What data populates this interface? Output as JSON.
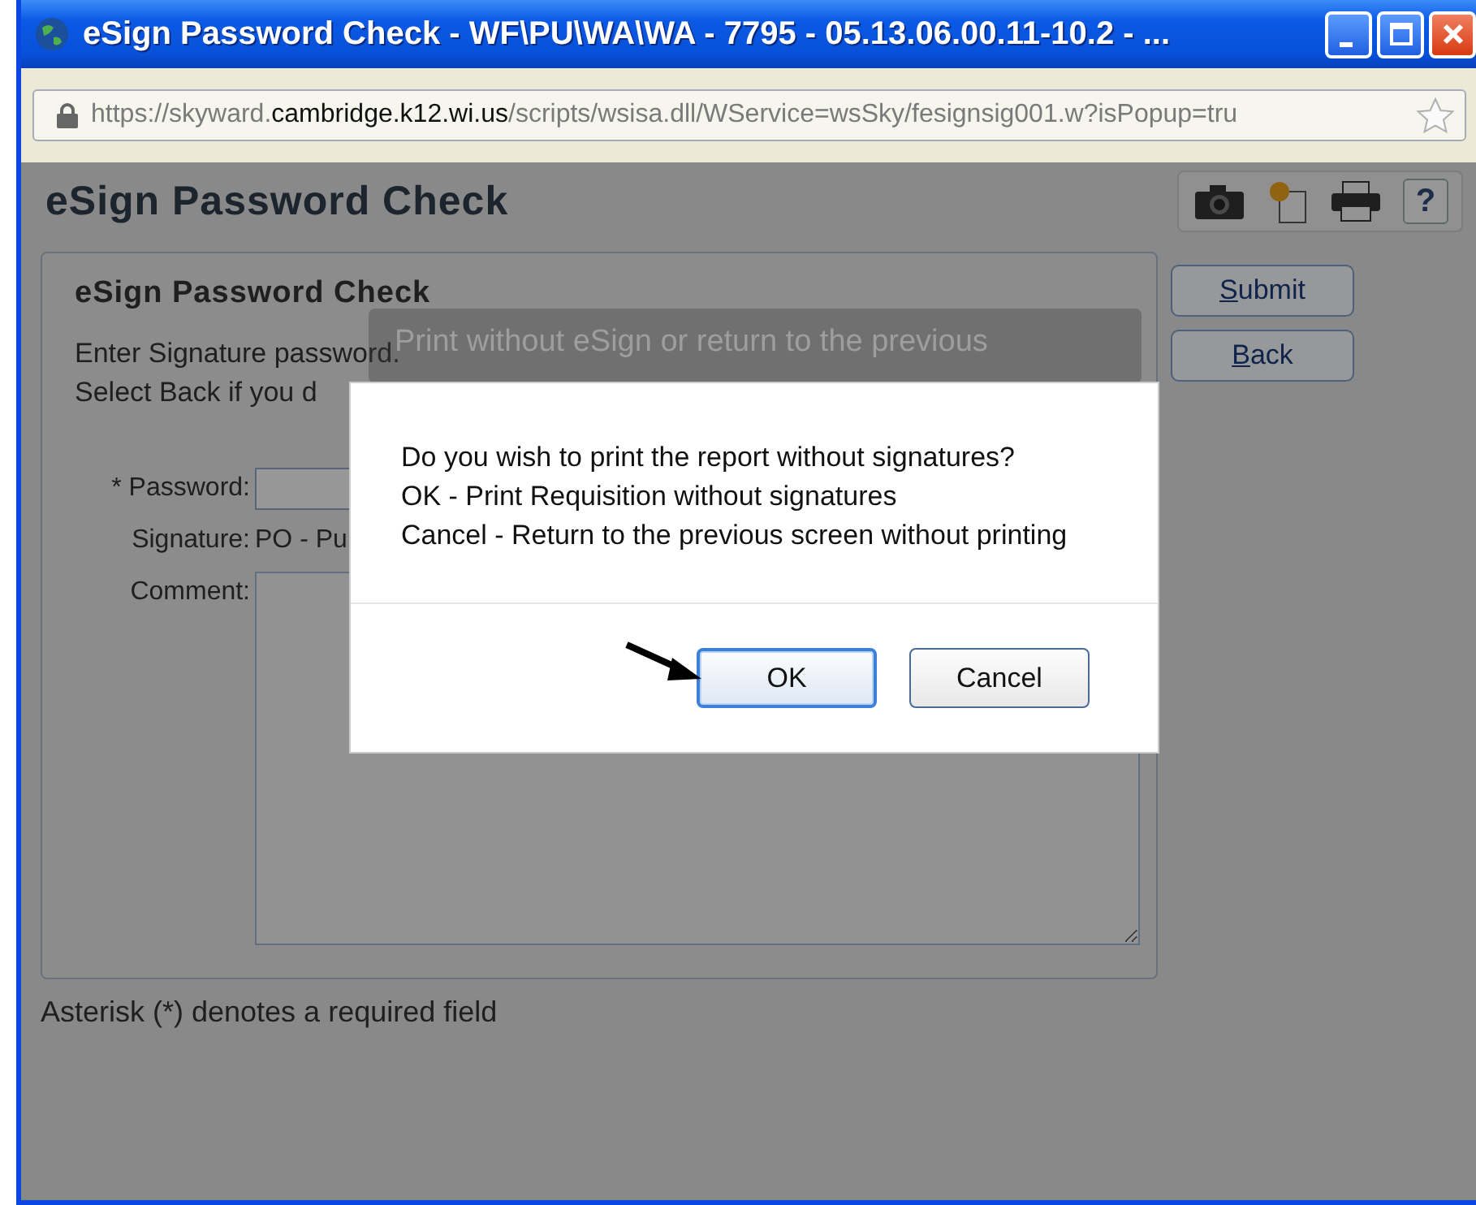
{
  "window": {
    "title": "eSign Password Check - WF\\PU\\WA\\WA - 7795 - 05.13.06.00.11-10.2 - ..."
  },
  "address_bar": {
    "url_prefix": "https://skyward.",
    "url_domain": "cambridge.k12.wi.us",
    "url_suffix": "/scripts/wsisa.dll/WService=wsSky/fesignsig001.w?isPopup=tru"
  },
  "page": {
    "title": "eSign Password Check",
    "help_label": "?"
  },
  "form": {
    "title": "eSign Password Check",
    "instructions": [
      "Enter Signature password.",
      "Select Back if you d"
    ],
    "fields": [
      {
        "kind": "input",
        "label": "* Password:"
      },
      {
        "kind": "text",
        "label": "Signature:",
        "value": "PO - Pu"
      },
      {
        "kind": "textarea",
        "label": "Comment:"
      }
    ]
  },
  "side_buttons": [
    {
      "label": "Submit"
    },
    {
      "label": "Back"
    }
  ],
  "footer_note": "Asterisk (*) denotes a required field",
  "tooltip": {
    "text": "Print without eSign or return to the previous"
  },
  "dialog": {
    "lines": [
      "Do you wish to print the report without signatures?",
      "OK - Print Requisition without signatures",
      "Cancel - Return to the previous screen without printing"
    ],
    "buttons": [
      {
        "label": "OK",
        "default": true
      },
      {
        "label": "Cancel",
        "default": false
      }
    ]
  }
}
